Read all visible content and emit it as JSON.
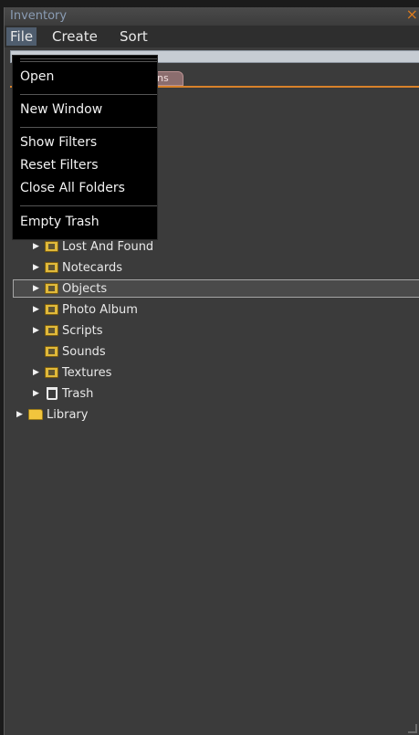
{
  "window": {
    "title": "Inventory",
    "close_glyph": "×"
  },
  "menubar": {
    "file": "File",
    "create": "Create",
    "sort": "Sort"
  },
  "tabs": {
    "recent_fragment": "ns"
  },
  "file_menu": {
    "items": [
      "Open",
      "New Window",
      "Show Filters",
      "Reset Filters",
      "Close All Folders",
      "Empty Trash"
    ]
  },
  "tree": {
    "items": [
      {
        "label": "Lost And Found",
        "icon": "lost-and-found-folder-icon",
        "has_arrow": true
      },
      {
        "label": "Notecards",
        "icon": "notecard-folder-icon",
        "has_arrow": true
      },
      {
        "label": "Objects",
        "icon": "object-folder-icon",
        "has_arrow": true,
        "selected": true
      },
      {
        "label": "Photo Album",
        "icon": "photo-folder-icon",
        "has_arrow": true
      },
      {
        "label": "Scripts",
        "icon": "script-folder-icon",
        "has_arrow": true
      },
      {
        "label": "Sounds",
        "icon": "sound-folder-icon",
        "has_arrow": false
      },
      {
        "label": "Textures",
        "icon": "texture-folder-icon",
        "has_arrow": true
      },
      {
        "label": "Trash",
        "icon": "trash-icon",
        "has_arrow": true
      }
    ],
    "library": {
      "label": "Library",
      "icon": "folder-icon"
    }
  },
  "colors": {
    "accent": "#d8822a",
    "title_text": "#8a9cb4",
    "folder_yellow": "#f2c53d"
  }
}
